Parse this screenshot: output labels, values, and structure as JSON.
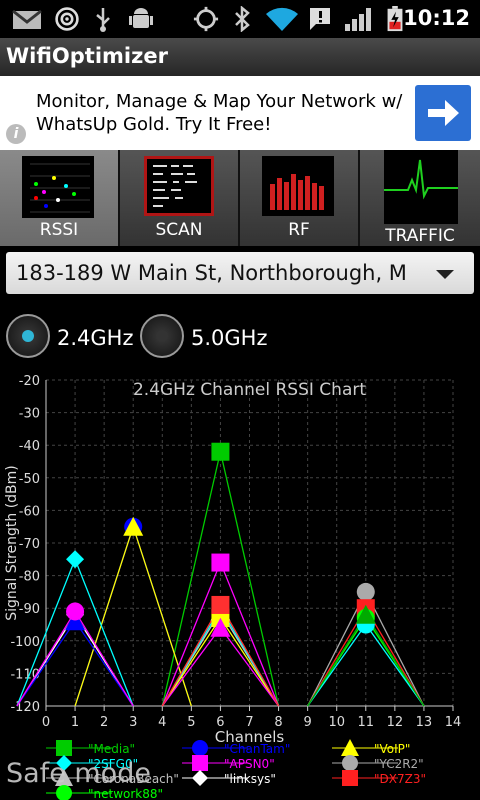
{
  "status_bar": {
    "time": "10:12",
    "icons": [
      "gmail-icon",
      "app-swirl-icon",
      "usb-icon",
      "android-debug-icon",
      "gps-icon",
      "bluetooth-icon",
      "wifi-icon",
      "alert-icon",
      "signal-icon",
      "battery-charging-icon"
    ]
  },
  "app": {
    "title": "WifiOptimizer"
  },
  "ad": {
    "text": "Monitor, Manage & Map Your Network w/ WhatsUp Gold. Try It Free!",
    "info_glyph": "i",
    "button_icon": "arrow-right-icon"
  },
  "tabs": [
    {
      "label": "RSSI",
      "selected": true
    },
    {
      "label": "SCAN",
      "selected": false
    },
    {
      "label": "RF",
      "selected": false
    },
    {
      "label": "TRAFFIC",
      "selected": false
    }
  ],
  "location": {
    "value": "183-189 W Main St, Northborough, M"
  },
  "bands": [
    {
      "label": "2.4GHz",
      "selected": true,
      "dot_color": "#2fb6d6"
    },
    {
      "label": "5.0GHz",
      "selected": false,
      "dot_color": "#333333"
    }
  ],
  "safe_mode": "Safe mode",
  "chart_data": {
    "type": "line",
    "title": "2.4GHz Channel RSSI Chart",
    "xlabel": "Channels",
    "ylabel": "Signal Strength (dBm)",
    "xlim": [
      0,
      14
    ],
    "ylim": [
      -120,
      -20
    ],
    "x_ticks": [
      0,
      1,
      2,
      3,
      4,
      5,
      6,
      7,
      8,
      9,
      10,
      11,
      12,
      13,
      14
    ],
    "y_ticks": [
      -20,
      -30,
      -40,
      -50,
      -60,
      -70,
      -80,
      -90,
      -100,
      -110,
      -120
    ],
    "grid": true,
    "series": [
      {
        "name": "\"Media\"",
        "color": "#00cc00",
        "marker": "square",
        "channel": 6,
        "rssi": -42
      },
      {
        "name": "\"ChanTam\"",
        "color": "#0000ff",
        "marker": "circle",
        "channel": 3,
        "rssi": -65
      },
      {
        "name": "\"VoIP\"",
        "color": "#ffff00",
        "marker": "triangle",
        "channel": 3,
        "rssi": -65
      },
      {
        "name": "\"2SFG0\"",
        "color": "#00ffff",
        "marker": "diamond",
        "channel": 1,
        "rssi": -75
      },
      {
        "name": "\"APSN0\"",
        "color": "#ff00ff",
        "marker": "square",
        "channel": 6,
        "rssi": -76
      },
      {
        "name": "\"YC2R2\"",
        "color": "#aaaaaa",
        "marker": "circle",
        "channel": 11,
        "rssi": -85
      },
      {
        "name": "\"CoronaBeach\"",
        "color": "#c0c0c0",
        "marker": "triangle",
        "channel": 6,
        "rssi": -91
      },
      {
        "name": "\"linksys\"",
        "color": "#ffffff",
        "marker": "diamond",
        "channel": 1,
        "rssi": -92
      },
      {
        "name": "\"DX7Z3\"",
        "color": "#ff2020",
        "marker": "square",
        "channel": 11,
        "rssi": -90
      },
      {
        "name": "\"network88\"",
        "color": "#00ff00",
        "marker": "circle",
        "channel": 11,
        "rssi": -93
      },
      {
        "name": "",
        "color": "#0000ff",
        "marker": "triangle",
        "channel": 1,
        "rssi": -94
      },
      {
        "name": "",
        "color": "#ff00ff",
        "marker": "circle",
        "channel": 1,
        "rssi": -91
      },
      {
        "name": "",
        "color": "#00ffff",
        "marker": "diamond",
        "channel": 6,
        "rssi": -90
      },
      {
        "name": "",
        "color": "#ffff00",
        "marker": "square",
        "channel": 6,
        "rssi": -93
      },
      {
        "name": "",
        "color": "#ff00ff",
        "marker": "triangle",
        "channel": 6,
        "rssi": -96
      },
      {
        "name": "",
        "color": "#ff3030",
        "marker": "square",
        "channel": 6,
        "rssi": -89
      },
      {
        "name": "",
        "color": "#00ffff",
        "marker": "circle",
        "channel": 11,
        "rssi": -95
      },
      {
        "name": "",
        "color": "#00aa00",
        "marker": "triangle",
        "channel": 11,
        "rssi": -92
      }
    ],
    "legend_visible": [
      "\"Media\"",
      "\"ChanTam\"",
      "\"VoIP\"",
      "\"2SFG0\"",
      "\"APSN0\"",
      "\"YC2R2\"",
      "\"CoronaBeach\"",
      "\"linksys\"",
      "\"DX7Z3\"",
      "\"network88\""
    ],
    "legend_position": "bottom"
  }
}
